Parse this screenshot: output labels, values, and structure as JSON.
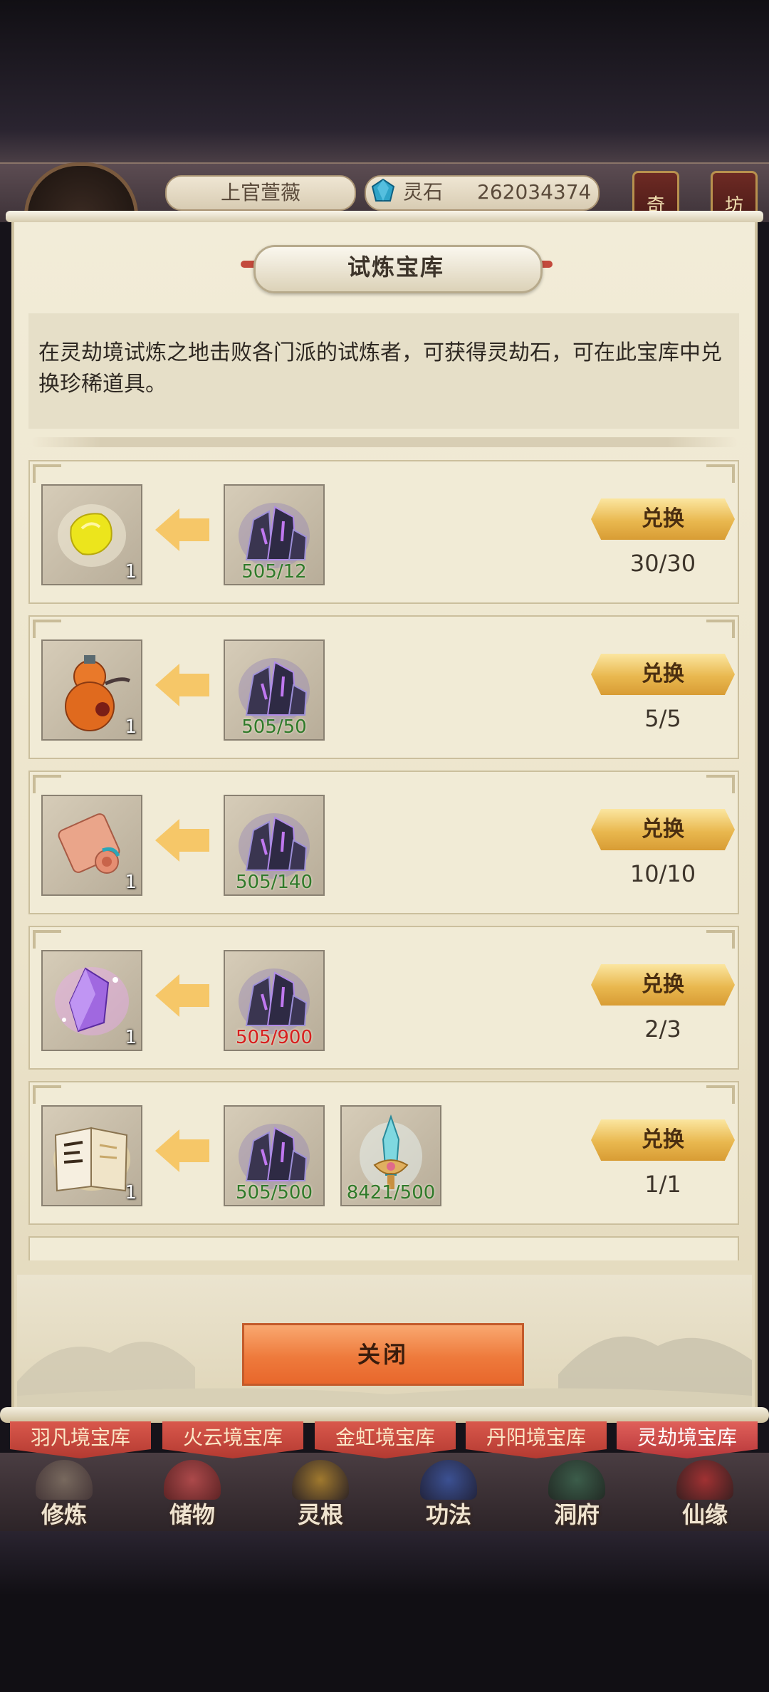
{
  "header": {
    "player_name": "上官萱薇",
    "currency_label": "灵石",
    "currency_value": "262034374",
    "side_buttons": [
      "奇",
      "坊"
    ]
  },
  "panel": {
    "title": "试炼宝库",
    "description": "在灵劫境试炼之地击败各门派的试炼者，可获得灵劫石，可在此宝库中兑换珍稀道具。",
    "close_label": "关闭"
  },
  "rewards": [
    {
      "item": "yellow-stone-icon",
      "count": "1",
      "costs": [
        {
          "item": "dark-crystal-icon",
          "text": "505/12",
          "sufficient": true
        }
      ],
      "button": "兑换",
      "limit": "30/30"
    },
    {
      "item": "gourd-icon",
      "count": "1",
      "costs": [
        {
          "item": "dark-crystal-icon",
          "text": "505/50",
          "sufficient": true
        }
      ],
      "button": "兑换",
      "limit": "5/5"
    },
    {
      "item": "scroll-icon",
      "count": "1",
      "costs": [
        {
          "item": "dark-crystal-icon",
          "text": "505/140",
          "sufficient": true
        }
      ],
      "button": "兑换",
      "limit": "10/10"
    },
    {
      "item": "purple-crystal-icon",
      "count": "1",
      "costs": [
        {
          "item": "dark-crystal-icon",
          "text": "505/900",
          "sufficient": false
        }
      ],
      "button": "兑换",
      "limit": "2/3"
    },
    {
      "item": "book-icon",
      "count": "1",
      "costs": [
        {
          "item": "dark-crystal-icon",
          "text": "505/500",
          "sufficient": true
        },
        {
          "item": "sword-token-icon",
          "text": "8421/500",
          "sufficient": true
        }
      ],
      "button": "兑换",
      "limit": "1/1"
    }
  ],
  "tabs": [
    {
      "label": "羽凡境宝库",
      "active": false
    },
    {
      "label": "火云境宝库",
      "active": false
    },
    {
      "label": "金虹境宝库",
      "active": false
    },
    {
      "label": "丹阳境宝库",
      "active": false
    },
    {
      "label": "灵劫境宝库",
      "active": true
    }
  ],
  "nav": [
    {
      "label": "修炼"
    },
    {
      "label": "储物"
    },
    {
      "label": "灵根"
    },
    {
      "label": "功法"
    },
    {
      "label": "洞府"
    },
    {
      "label": "仙缘"
    }
  ],
  "colors": {
    "accent_gold": "#e9b84f",
    "tab_red": "#c4463c",
    "cost_ok": "#2f7a2a",
    "cost_insufficient": "#d81e1e"
  }
}
